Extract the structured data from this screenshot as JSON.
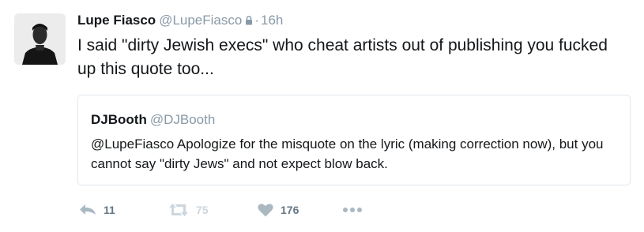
{
  "tweet": {
    "author_name": "Lupe Fiasco",
    "author_handle": "@LupeFiasco",
    "separator": "·",
    "time": "16h",
    "text": "I said \"dirty Jewish execs\" who cheat artists out of publishing you fucked up this quote too...",
    "icons": {
      "avatar": "avatar-photo",
      "protected": "lock-icon"
    }
  },
  "quote": {
    "author_name": "DJBooth",
    "author_handle": "@DJBooth",
    "text": "@LupeFiasco Apologize for the misquote on the lyric (making correction now), but you cannot say \"dirty Jews\" and not expect blow back."
  },
  "actions": {
    "reply_count": "11",
    "retweet_count": "75",
    "like_count": "176",
    "icons": [
      "reply-icon",
      "retweet-icon",
      "heart-icon",
      "more-icon"
    ]
  },
  "colors": {
    "primary_text": "#14171a",
    "secondary_text": "#8899a6",
    "action_gray": "#aab8c2",
    "border": "#e1e8ed"
  }
}
